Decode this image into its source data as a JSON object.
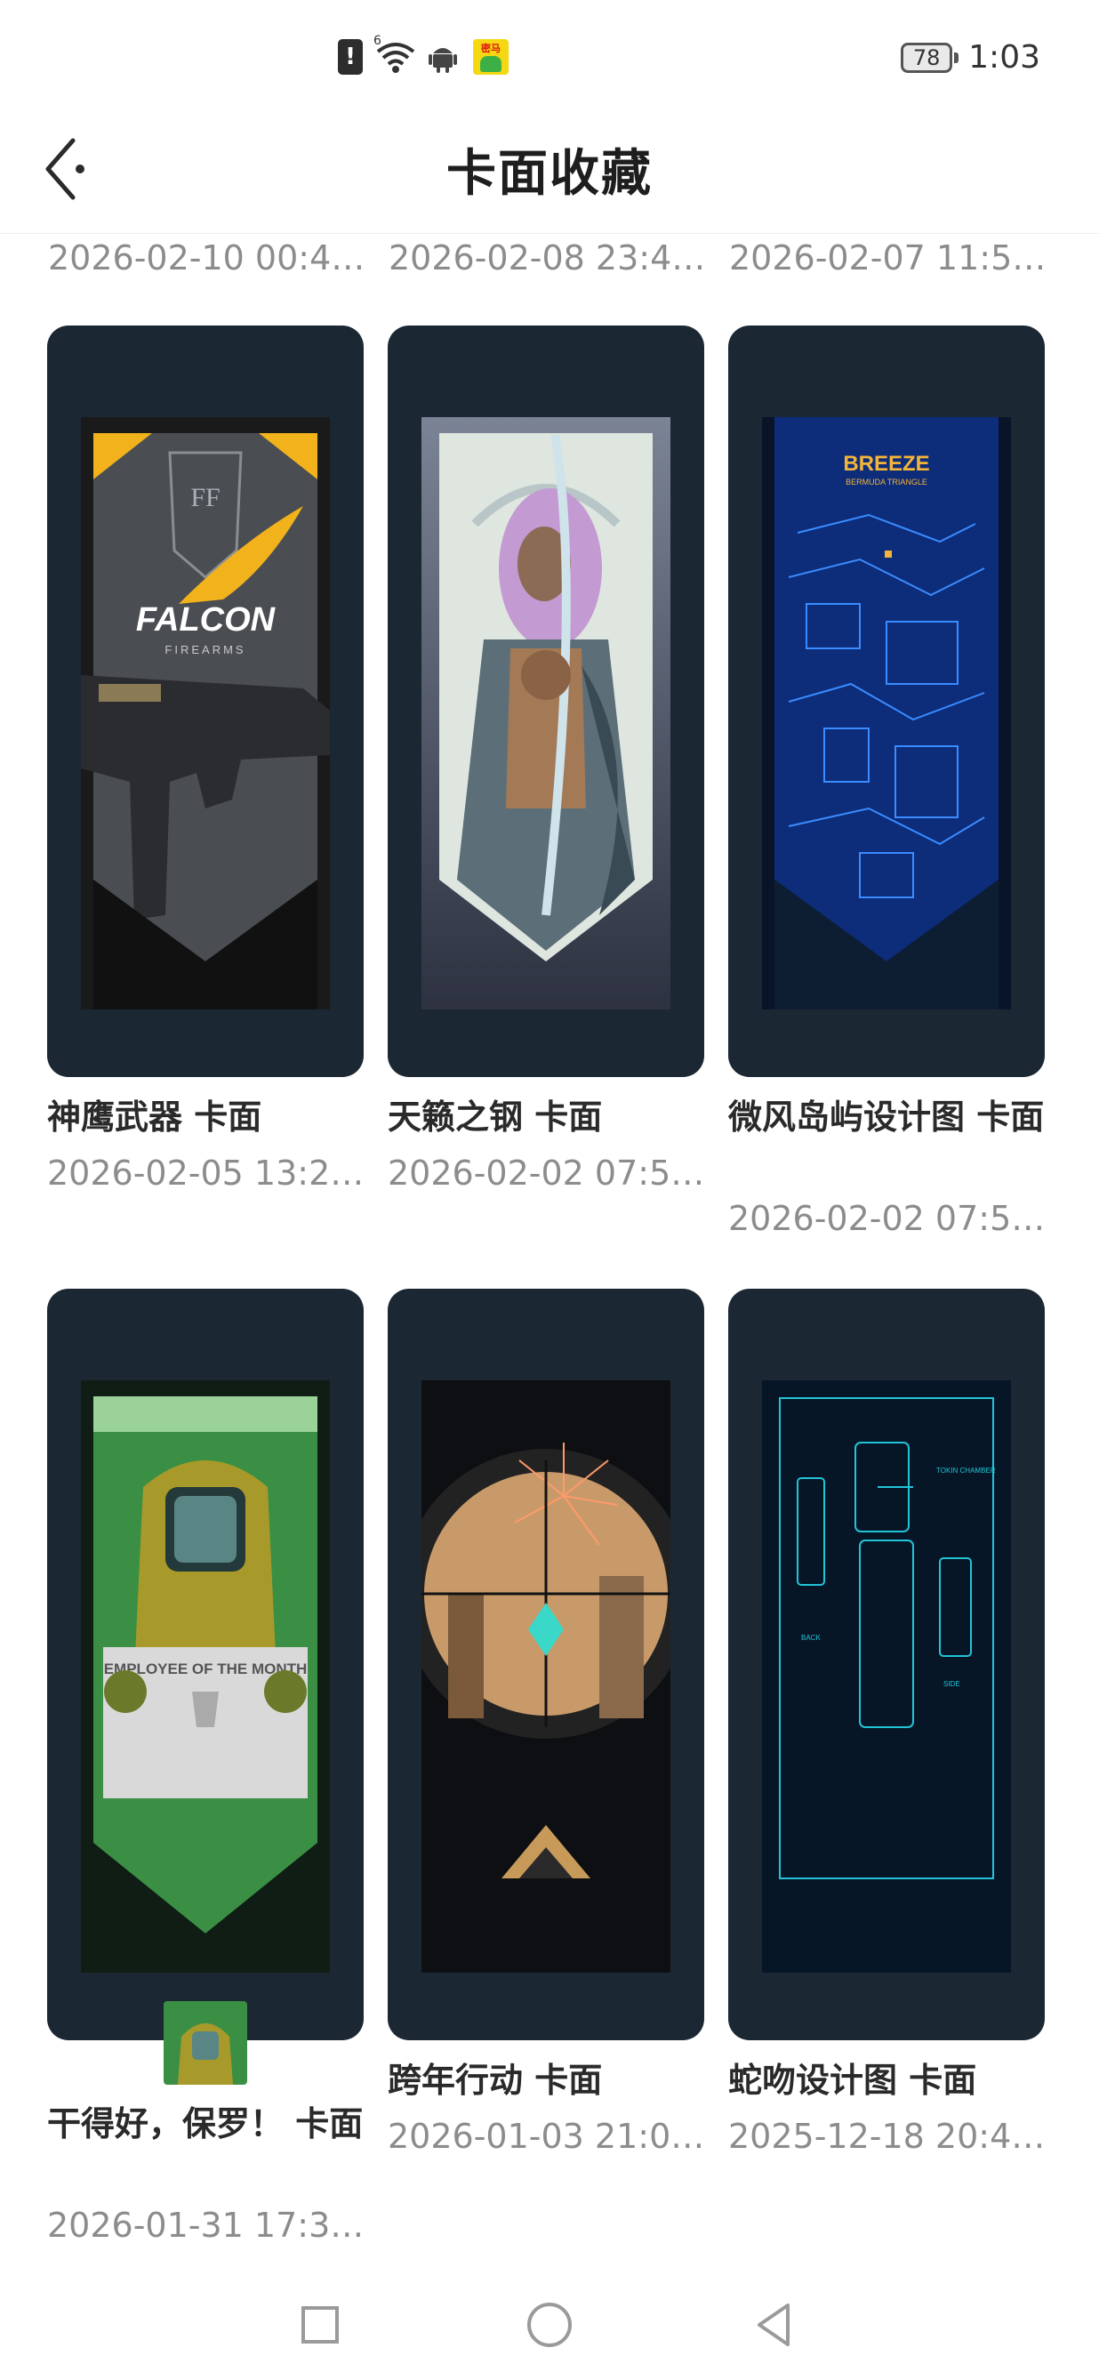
{
  "status_bar": {
    "icons": [
      "sim-alert-icon",
      "wifi-icon",
      "android-icon",
      "app-notification-icon"
    ],
    "sim_glyph": "!",
    "wifi_label": "6",
    "app_badge_text": "密马",
    "battery_level": "78",
    "time": "1:03"
  },
  "header": {
    "title": "卡面收藏"
  },
  "top_row_dates": [
    "2026-02-10 00:42:…",
    "2026-02-08 23:46:…",
    "2026-02-07 11:59:…"
  ],
  "cards": [
    {
      "title": "神鹰武器 卡面",
      "date": "2026-02-05 13:21:…",
      "art": "falcon"
    },
    {
      "title": "天籁之钢 卡面",
      "date": "2026-02-02 07:58:…",
      "art": "elf"
    },
    {
      "title": "微风岛屿设计图 卡面",
      "date": "2026-02-02 07:58:…",
      "art": "breeze"
    },
    {
      "title": "干得好，保罗！ 卡面",
      "date": "2026-01-31 17:30:…",
      "art": "employee"
    },
    {
      "title": "跨年行动 卡面",
      "date": "2026-01-03 21:05:…",
      "art": "scope"
    },
    {
      "title": "蛇吻设计图 卡面",
      "date": "2025-12-18 20:49:…",
      "art": "blueprint"
    }
  ],
  "art_text": {
    "falcon_brand": "FALCON",
    "falcon_sub": "FIREARMS",
    "falcon_monogram": "FF",
    "breeze_title": "BREEZE",
    "breeze_sub": "BERMUDA TRIANGLE",
    "employee_banner": "EMPLOYEE OF THE MONTH",
    "blueprint_label_1": "TOKIN CHAMBER",
    "blueprint_label_2": "BACK",
    "blueprint_label_3": "SIDE"
  },
  "colors": {
    "card_bg": "#1c2734",
    "title_text": "#2a2a2a",
    "date_text": "#8c8c8c"
  },
  "nav": {
    "icons": [
      "recents-square-icon",
      "home-circle-icon",
      "back-triangle-icon"
    ]
  }
}
